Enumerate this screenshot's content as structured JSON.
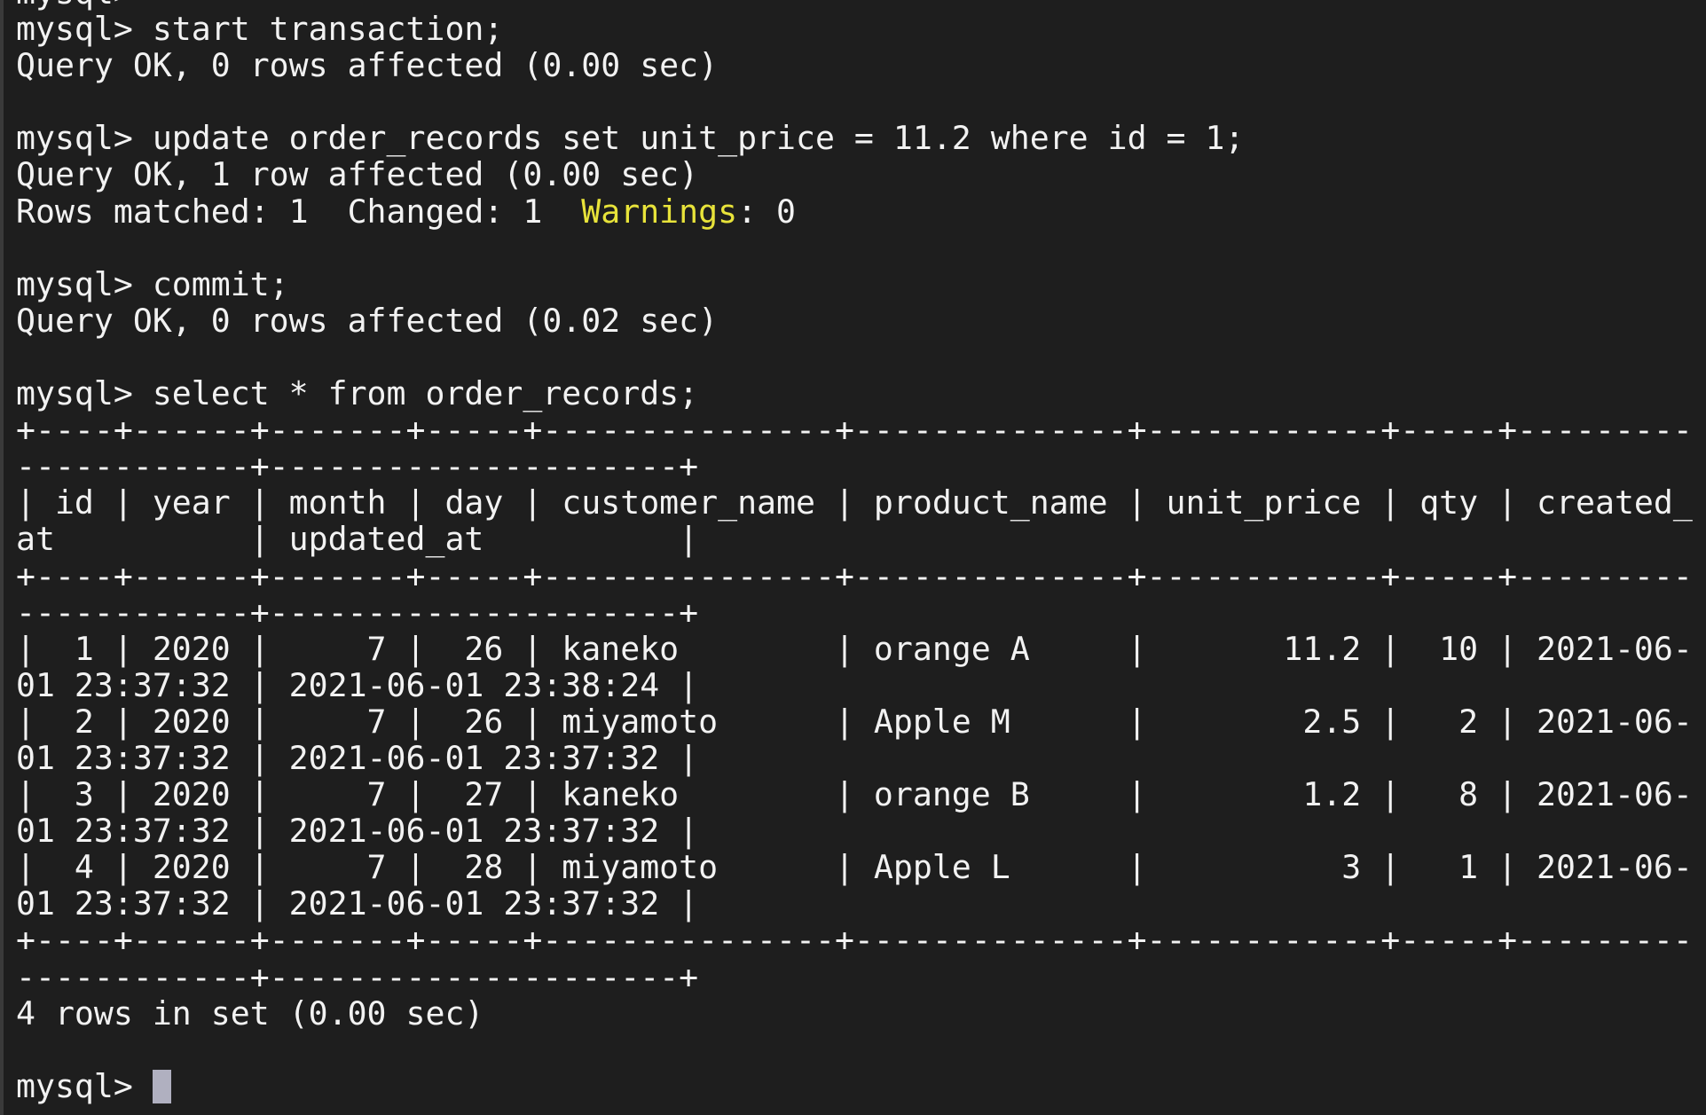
{
  "terminal": {
    "top_fragment": "mysql>",
    "prompt": "mysql> ",
    "session": [
      {
        "kind": "command",
        "text": "start transaction;"
      },
      {
        "kind": "output",
        "text": "Query OK, 0 rows affected (0.00 sec)"
      },
      {
        "kind": "blank"
      },
      {
        "kind": "command",
        "text": "update order_records set unit_price = 11.2 where id = 1;"
      },
      {
        "kind": "output",
        "text": "Query OK, 1 row affected (0.00 sec)"
      },
      {
        "kind": "warnings",
        "before": "Rows matched: 1  Changed: 1  ",
        "highlight": "Warnings",
        "after": ": 0"
      },
      {
        "kind": "blank"
      },
      {
        "kind": "command",
        "text": "commit;"
      },
      {
        "kind": "output",
        "text": "Query OK, 0 rows affected (0.02 sec)"
      },
      {
        "kind": "blank"
      },
      {
        "kind": "command",
        "text": "select * from order_records;"
      }
    ],
    "result_table": {
      "columns": [
        "id",
        "year",
        "month",
        "day",
        "customer_name",
        "product_name",
        "unit_price",
        "qty",
        "created_at",
        "updated_at"
      ],
      "rows": [
        [
          "1",
          "2020",
          "7",
          "26",
          "kaneko",
          "orange A",
          "11.2",
          "10",
          "2021-06-01 23:37:32",
          "2021-06-01 23:38:24"
        ],
        [
          "2",
          "2020",
          "7",
          "26",
          "miyamoto",
          "Apple M",
          "2.5",
          "2",
          "2021-06-01 23:37:32",
          "2021-06-01 23:37:32"
        ],
        [
          "3",
          "2020",
          "7",
          "27",
          "kaneko",
          "orange B",
          "1.2",
          "8",
          "2021-06-01 23:37:32",
          "2021-06-01 23:37:32"
        ],
        [
          "4",
          "2020",
          "7",
          "28",
          "miyamoto",
          "Apple L",
          "3",
          "1",
          "2021-06-01 23:37:32",
          "2021-06-01 23:37:32"
        ]
      ]
    },
    "result_summary": "4 rows in set (0.00 sec)",
    "colors": {
      "background": "#1e1e1e",
      "text": "#f2f2f2",
      "warning": "#e8e33a",
      "cursor": "#b0b0c0"
    }
  }
}
